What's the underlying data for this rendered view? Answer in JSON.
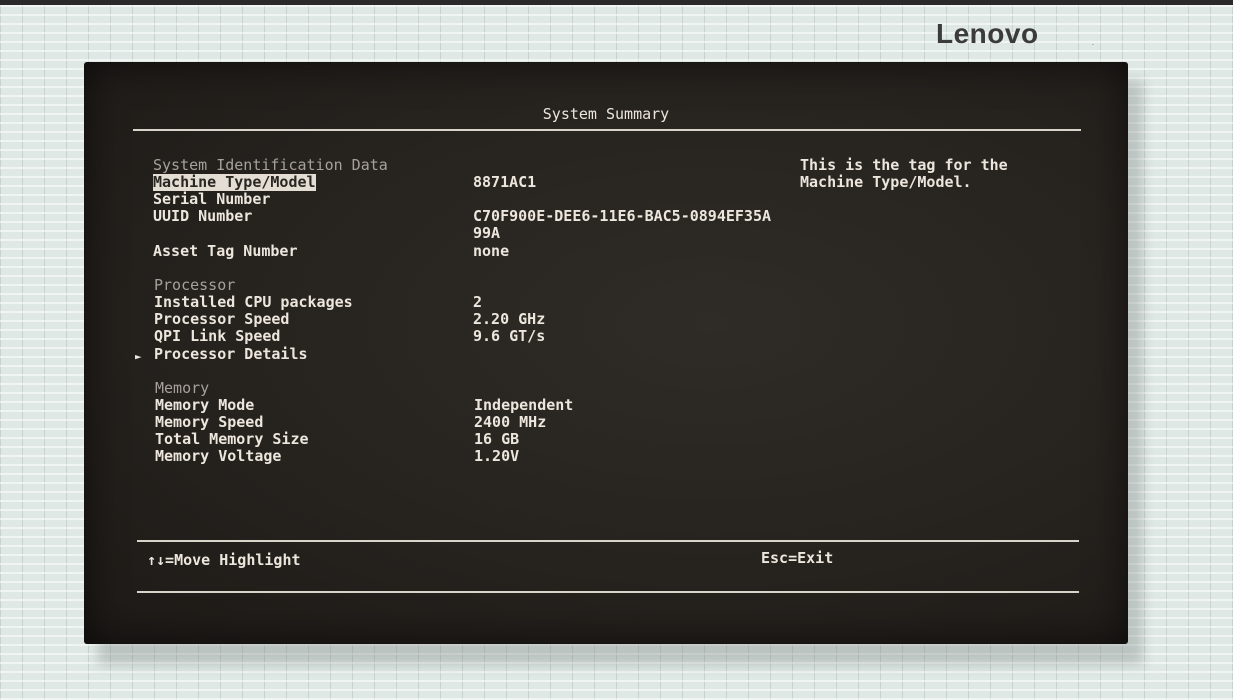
{
  "brand": {
    "name": "Lenovo",
    "mark": "."
  },
  "screen": {
    "title": "System Summary",
    "sections": {
      "identification": {
        "heading": "System Identification Data",
        "rows": [
          {
            "label": "Machine Type/Model",
            "value": "8871AC1"
          },
          {
            "label": "Serial Number",
            "value": ""
          },
          {
            "label": "UUID Number",
            "value": "C70F900E-DEE6-11E6-BAC5-0894EF35A",
            "value_cont": "99A"
          },
          {
            "label": "Asset Tag Number",
            "value": "none"
          }
        ]
      },
      "processor": {
        "heading": "Processor",
        "rows": [
          {
            "label": "Installed CPU packages",
            "value": "2"
          },
          {
            "label": "Processor Speed",
            "value": "2.20 GHz"
          },
          {
            "label": "QPI Link Speed",
            "value": "9.6 GT/s"
          }
        ],
        "details_label": "Processor Details",
        "details_marker": "►"
      },
      "memory": {
        "heading": "Memory",
        "rows": [
          {
            "label": "Memory Mode",
            "value": "Independent"
          },
          {
            "label": "Memory Speed",
            "value": "2400 MHz"
          },
          {
            "label": "Total Memory Size",
            "value": "16 GB"
          },
          {
            "label": "Memory Voltage",
            "value": "1.20V"
          }
        ]
      }
    },
    "help": {
      "line1": "This is the tag for the",
      "line2": "Machine Type/Model."
    },
    "footer": {
      "move_hint": "↑↓=Move Highlight",
      "exit_hint": "Esc=Exit"
    }
  }
}
